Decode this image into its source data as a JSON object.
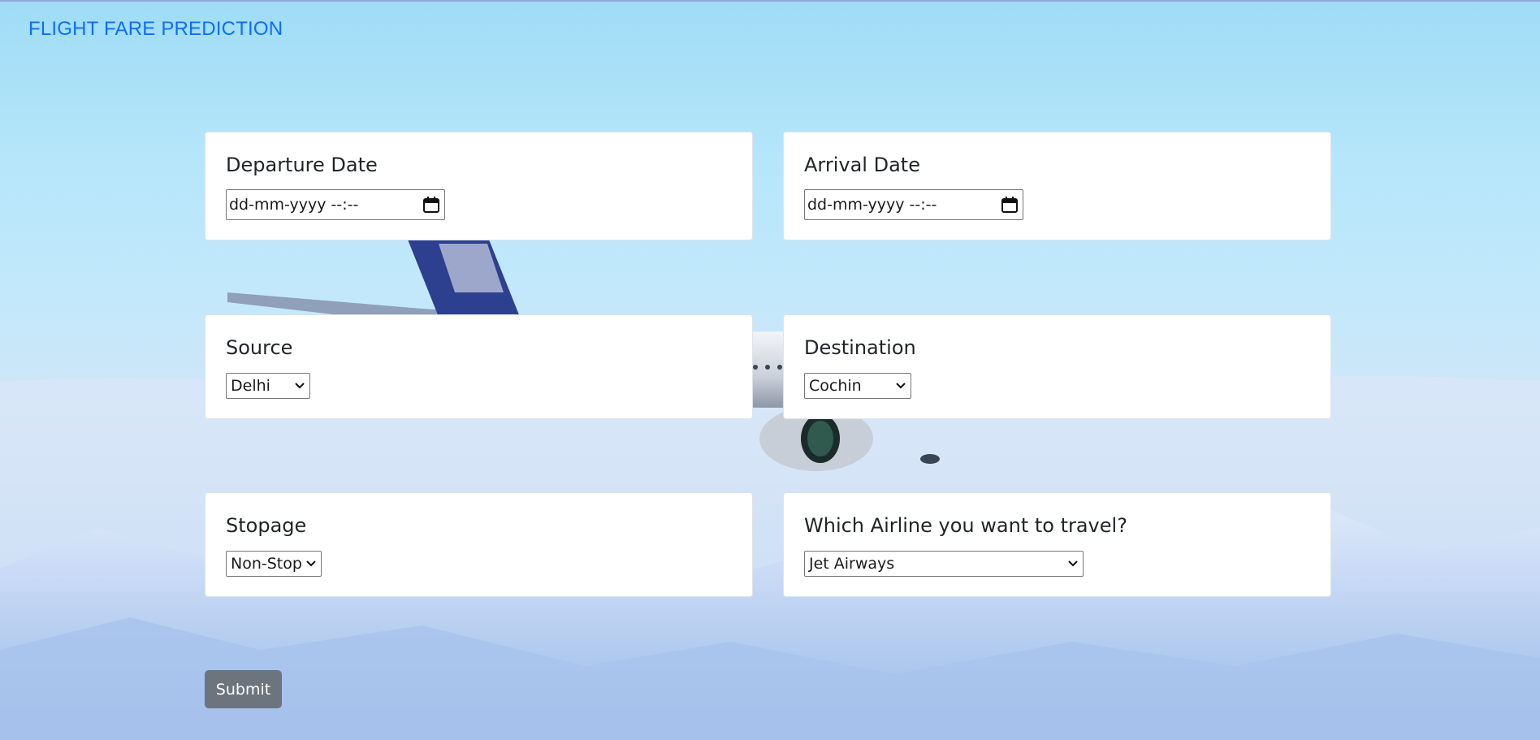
{
  "brand": "FLIGHT FARE PREDICTION",
  "fields": {
    "departure": {
      "label": "Departure Date",
      "placeholder": "dd-mm-yyyy --:--"
    },
    "arrival": {
      "label": "Arrival Date",
      "placeholder": "dd-mm-yyyy --:--"
    },
    "source": {
      "label": "Source",
      "value": "Delhi"
    },
    "destination": {
      "label": "Destination",
      "value": "Cochin"
    },
    "stopage": {
      "label": "Stopage",
      "value": "Non-Stop"
    },
    "airline": {
      "label": "Which Airline you want to travel?",
      "value": "Jet Airways"
    }
  },
  "submit_label": "Submit",
  "colors": {
    "brand": "#0d6efd",
    "button": "#6c757d",
    "card": "#ffffff",
    "sky": "#b6e6fa"
  },
  "icons": {
    "calendar": "calendar-icon",
    "chevron": "chevron-down-icon"
  }
}
